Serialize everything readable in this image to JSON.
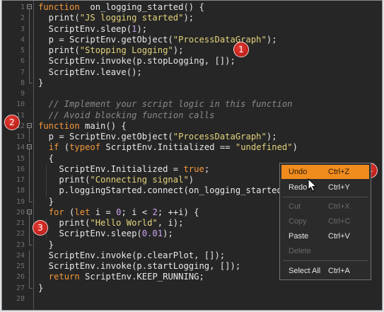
{
  "editor": {
    "lines": [
      {
        "n": "1",
        "fold": "box",
        "h": [
          [
            "kw",
            "function"
          ],
          [
            "",
            "  on_logging_started() {"
          ]
        ]
      },
      {
        "n": "2",
        "fold": "line",
        "h": [
          [
            "",
            "  print("
          ],
          [
            "str",
            "\"JS logging started\""
          ],
          [
            "",
            ");"
          ]
        ]
      },
      {
        "n": "3",
        "fold": "line",
        "h": [
          [
            "",
            "  ScriptEnv.sleep("
          ],
          [
            "num",
            "1"
          ],
          [
            "",
            ");"
          ]
        ]
      },
      {
        "n": "4",
        "fold": "line",
        "h": [
          [
            "",
            "  p = ScriptEnv.getObject("
          ],
          [
            "str",
            "\"ProcessDataGraph\""
          ],
          [
            "",
            ");"
          ]
        ]
      },
      {
        "n": "5",
        "fold": "line",
        "h": [
          [
            "",
            "  print("
          ],
          [
            "str",
            "\"Stopping Logging\""
          ],
          [
            "",
            ");"
          ]
        ]
      },
      {
        "n": "6",
        "fold": "line",
        "h": [
          [
            "",
            "  ScriptEnv.invoke(p.stopLogging, []);"
          ]
        ]
      },
      {
        "n": "7",
        "fold": "line",
        "h": [
          [
            "",
            "  ScriptEnv.leave();"
          ]
        ]
      },
      {
        "n": "8",
        "fold": "end",
        "h": [
          [
            "",
            "}"
          ]
        ]
      },
      {
        "n": "9",
        "fold": "",
        "h": []
      },
      {
        "n": "10",
        "fold": "",
        "h": [
          [
            "cm",
            "  // Implement your script logic in this function"
          ]
        ]
      },
      {
        "n": "11",
        "fold": "",
        "h": [
          [
            "cm",
            "  // Avoid blocking function calls"
          ]
        ]
      },
      {
        "n": "12",
        "fold": "box",
        "h": [
          [
            "kw",
            "function"
          ],
          [
            "",
            " main() {"
          ]
        ]
      },
      {
        "n": "13",
        "fold": "line",
        "h": [
          [
            "",
            "  p = ScriptEnv.getObject("
          ],
          [
            "str",
            "\"ProcessDataGraph\""
          ],
          [
            "",
            ");"
          ]
        ]
      },
      {
        "n": "14",
        "fold": "box",
        "h": [
          [
            "",
            "  "
          ],
          [
            "kw",
            "if"
          ],
          [
            "",
            " ("
          ],
          [
            "kw",
            "typeof"
          ],
          [
            "",
            " ScriptEnv.Initialized == "
          ],
          [
            "str",
            "\"undefined\""
          ],
          [
            "",
            ")"
          ]
        ]
      },
      {
        "n": "15",
        "fold": "line",
        "h": [
          [
            "",
            "  {"
          ]
        ]
      },
      {
        "n": "16",
        "fold": "line",
        "h": [
          [
            "",
            "    ScriptEnv.Initialized = "
          ],
          [
            "kw",
            "true"
          ],
          [
            "",
            ";"
          ]
        ]
      },
      {
        "n": "17",
        "fold": "line",
        "h": [
          [
            "",
            "    print("
          ],
          [
            "str",
            "\"Connecting signal\""
          ],
          [
            "",
            ")"
          ]
        ]
      },
      {
        "n": "18",
        "fold": "line",
        "h": [
          [
            "",
            "    p.loggingStarted.connect(on_logging_started);"
          ]
        ]
      },
      {
        "n": "19",
        "fold": "end",
        "h": [
          [
            "",
            "  }"
          ]
        ]
      },
      {
        "n": "20",
        "fold": "box",
        "h": [
          [
            "",
            "  "
          ],
          [
            "kw",
            "for"
          ],
          [
            "",
            " ("
          ],
          [
            "kw",
            "let"
          ],
          [
            "",
            " i = "
          ],
          [
            "num",
            "0"
          ],
          [
            "",
            "; i < "
          ],
          [
            "num",
            "2"
          ],
          [
            "",
            "; ++i) {"
          ]
        ]
      },
      {
        "n": "21",
        "fold": "line",
        "h": [
          [
            "",
            "    print("
          ],
          [
            "str",
            "\"Hello World\""
          ],
          [
            "",
            ", i);"
          ]
        ]
      },
      {
        "n": "22",
        "fold": "line",
        "h": [
          [
            "",
            "    ScriptEnv.sleep("
          ],
          [
            "num",
            "0.01"
          ],
          [
            "",
            ");"
          ]
        ]
      },
      {
        "n": "23",
        "fold": "end",
        "h": [
          [
            "",
            "  }"
          ]
        ]
      },
      {
        "n": "24",
        "fold": "line",
        "h": [
          [
            "",
            "  ScriptEnv.invoke(p.clearPlot, []);"
          ]
        ]
      },
      {
        "n": "25",
        "fold": "line",
        "h": [
          [
            "",
            "  ScriptEnv.invoke(p.startLogging, []);"
          ]
        ]
      },
      {
        "n": "26",
        "fold": "line",
        "h": [
          [
            "",
            "  "
          ],
          [
            "kw",
            "return"
          ],
          [
            "",
            " ScriptEnv.KEEP_RUNNING;"
          ]
        ]
      },
      {
        "n": "27",
        "fold": "end",
        "h": [
          [
            "",
            "}"
          ]
        ]
      },
      {
        "n": "28",
        "fold": "",
        "h": []
      }
    ]
  },
  "context_menu": {
    "items": [
      {
        "label": "Undo",
        "shortcut": "Ctrl+Z",
        "state": "highlighted"
      },
      {
        "label": "Redo",
        "shortcut": "Ctrl+Y",
        "state": "enabled"
      },
      {
        "label": "Cut",
        "shortcut": "Ctrl+X",
        "state": "disabled"
      },
      {
        "label": "Copy",
        "shortcut": "Ctrl+C",
        "state": "disabled"
      },
      {
        "label": "Paste",
        "shortcut": "Ctrl+V",
        "state": "enabled"
      },
      {
        "label": "Delete",
        "shortcut": "",
        "state": "disabled"
      },
      {
        "label": "Select All",
        "shortcut": "Ctrl+A",
        "state": "enabled"
      }
    ]
  },
  "callouts": [
    "1",
    "2",
    "3",
    "4"
  ],
  "colors": {
    "background": "#262626",
    "keyword": "#f4983a",
    "string": "#e3d37c",
    "number": "#c9a3f0",
    "comment": "#8a8a8a",
    "menu_highlight": "#f08c1e",
    "callout": "#c81e1a"
  }
}
